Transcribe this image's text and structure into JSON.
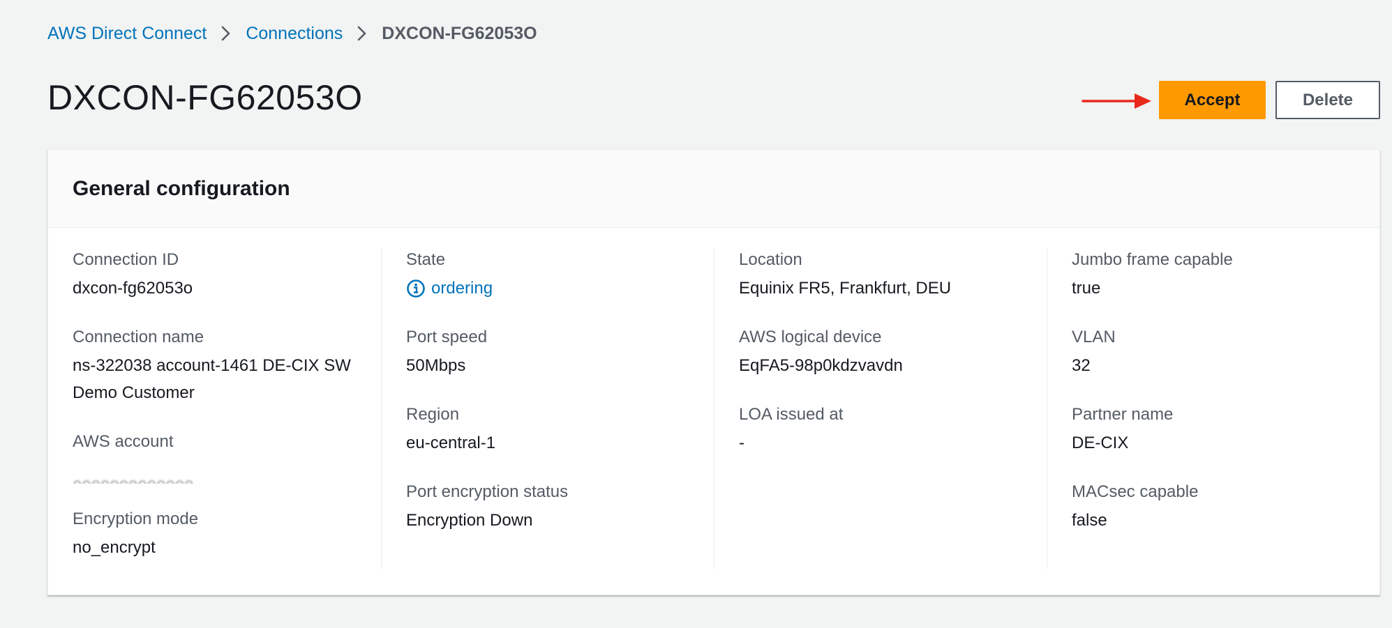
{
  "breadcrumb": {
    "items": [
      "AWS Direct Connect",
      "Connections"
    ],
    "current": "DXCON-FG62053O"
  },
  "page": {
    "title": "DXCON-FG62053O"
  },
  "actions": {
    "accept_label": "Accept",
    "delete_label": "Delete"
  },
  "colors": {
    "accent": "#ff9900",
    "link": "#0073bb",
    "annotation_arrow": "#e8291c"
  },
  "panel": {
    "title": "General configuration",
    "columns": [
      [
        {
          "label": "Connection ID",
          "value": "dxcon-fg62053o"
        },
        {
          "label": "Connection name",
          "value": "ns-322038 account-1461 DE-CIX SW Demo Customer"
        },
        {
          "label": "AWS account",
          "value": ""
        },
        {
          "label": "Encryption mode",
          "value": "no_encrypt"
        }
      ],
      [
        {
          "label": "State",
          "value": "ordering",
          "icon": "info-icon"
        },
        {
          "label": "Port speed",
          "value": "50Mbps"
        },
        {
          "label": "Region",
          "value": "eu-central-1"
        },
        {
          "label": "Port encryption status",
          "value": "Encryption Down"
        }
      ],
      [
        {
          "label": "Location",
          "value": "Equinix FR5, Frankfurt, DEU"
        },
        {
          "label": "AWS logical device",
          "value": "EqFA5-98p0kdzvavdn"
        },
        {
          "label": "LOA issued at",
          "value": "-"
        }
      ],
      [
        {
          "label": "Jumbo frame capable",
          "value": "true"
        },
        {
          "label": "VLAN",
          "value": "32"
        },
        {
          "label": "Partner name",
          "value": "DE-CIX"
        },
        {
          "label": "MACsec capable",
          "value": "false"
        }
      ]
    ]
  }
}
